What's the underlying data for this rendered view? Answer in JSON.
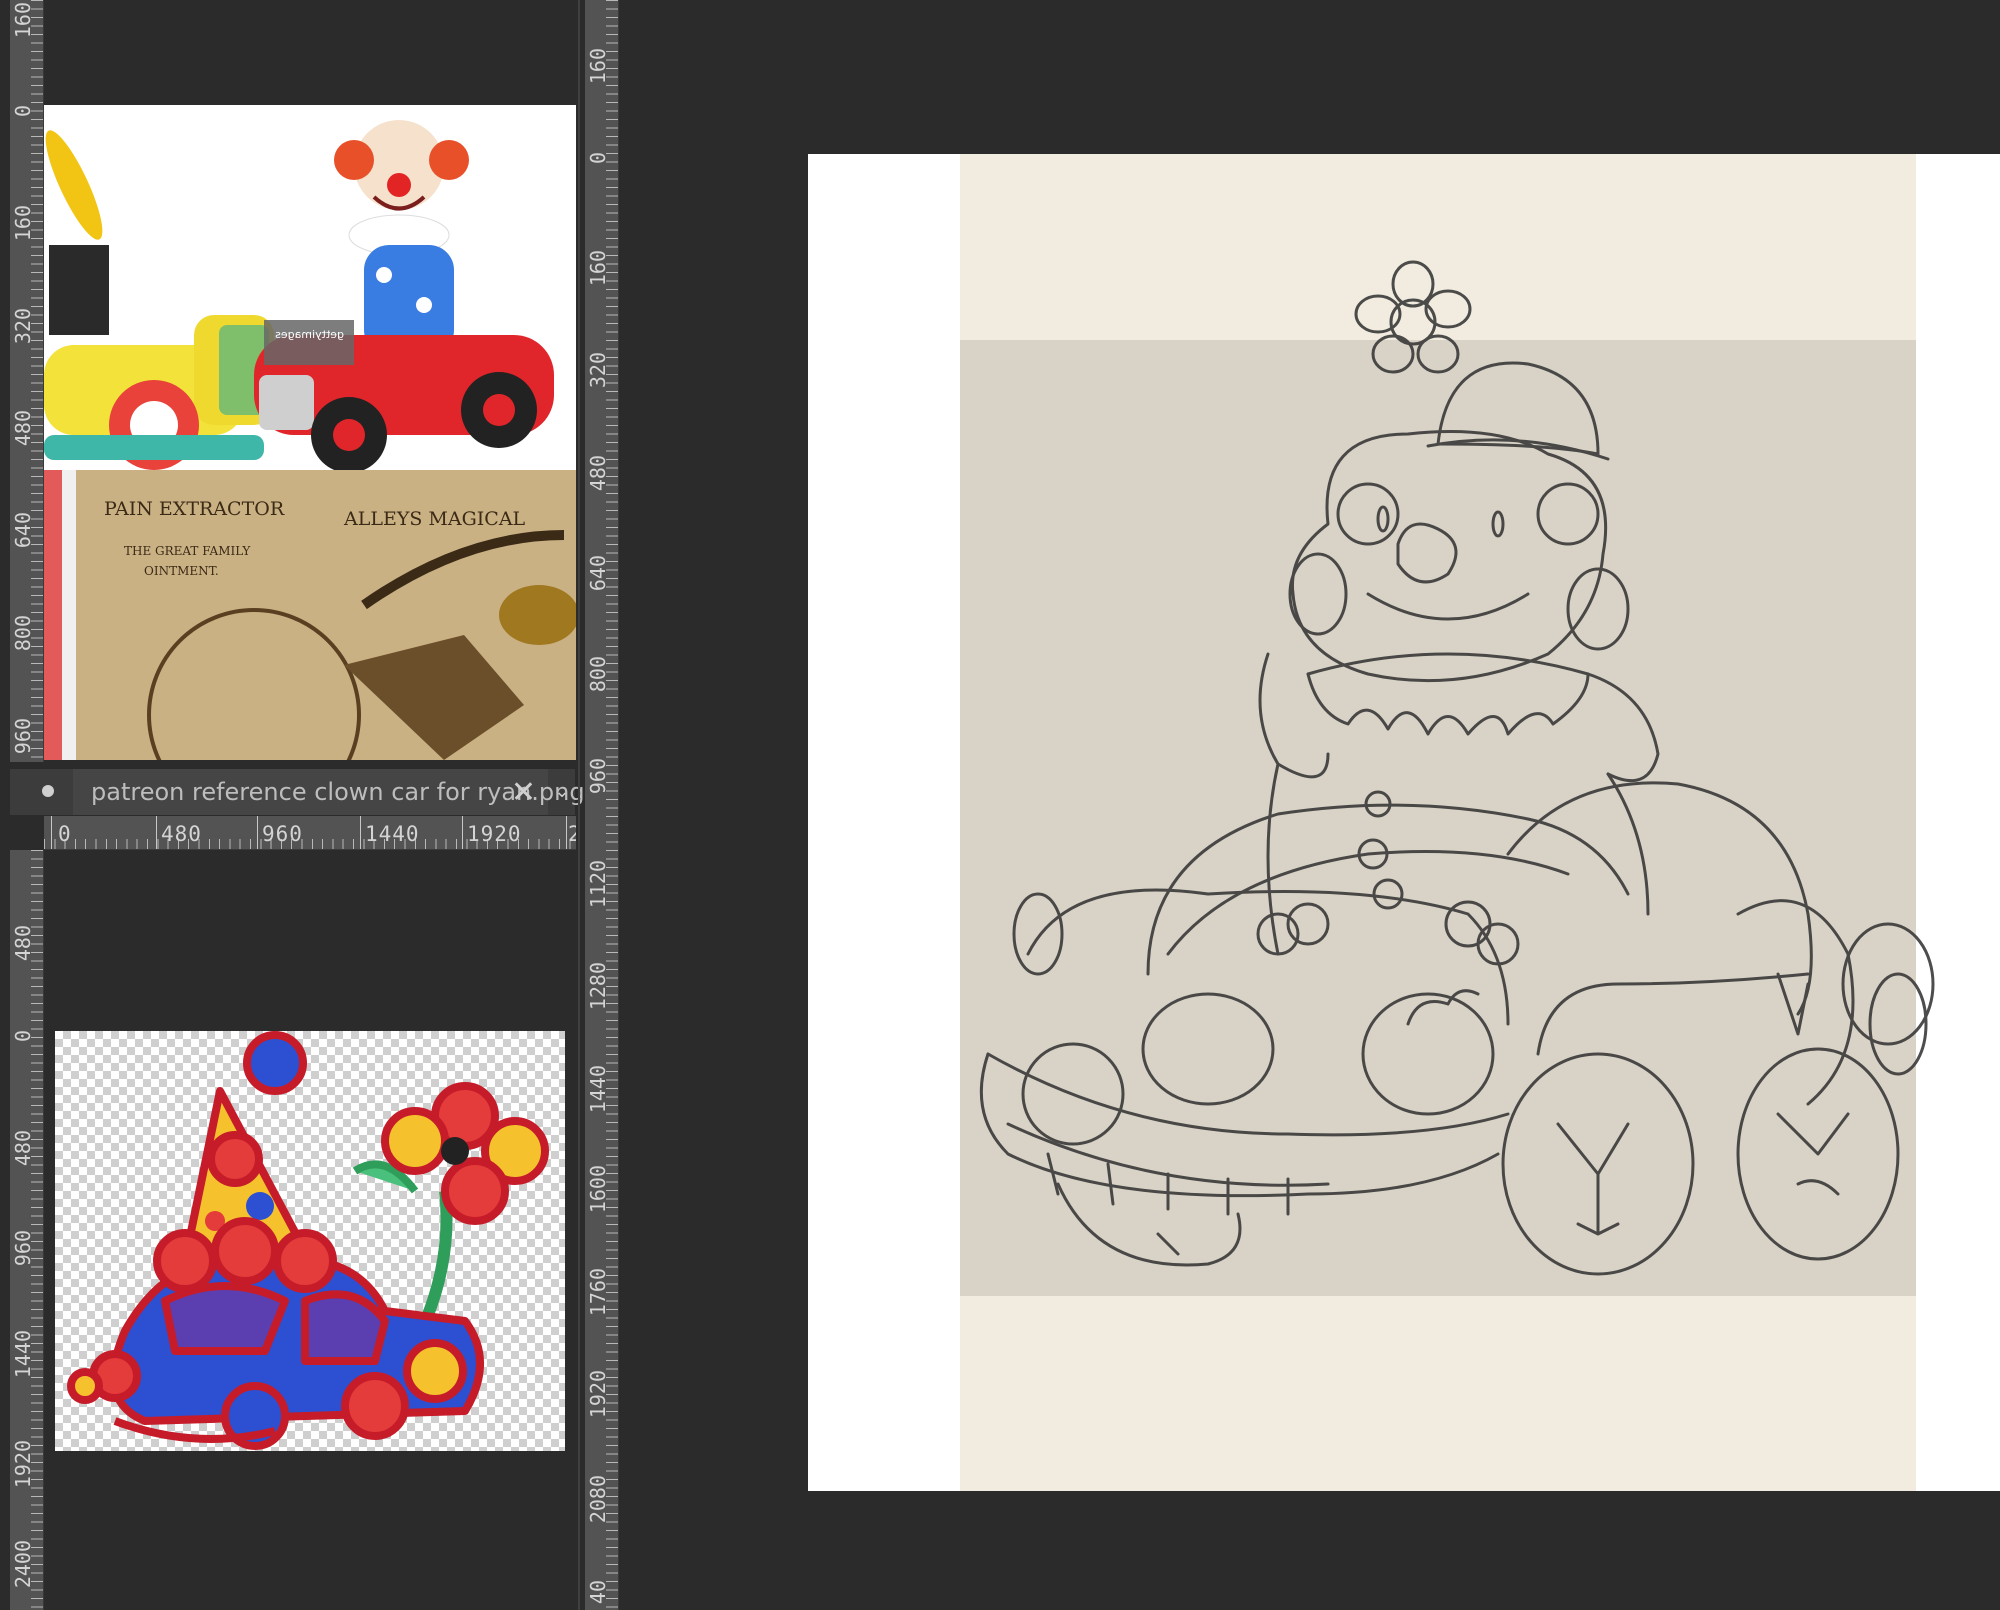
{
  "left_ruler_top": {
    "labels": [
      "160",
      "0",
      "160",
      "320",
      "480",
      "640",
      "800",
      "960"
    ]
  },
  "left_ruler_bottom": {
    "labels": [
      "480",
      "0",
      "480",
      "960",
      "1440",
      "1920",
      "2400"
    ]
  },
  "right_ruler": {
    "labels": [
      "160",
      "0",
      "160",
      "320",
      "480",
      "640",
      "800",
      "960",
      "1120",
      "1280",
      "1440",
      "1600",
      "1760",
      "1920",
      "2080",
      "40"
    ]
  },
  "reference_tab": {
    "label": "patreon reference clown car for ryan.png",
    "close_icon": "close-icon",
    "menu_icon": "chevron-down-icon"
  },
  "h_ruler": {
    "labels": [
      "0",
      "480",
      "960",
      "1440",
      "1920",
      "2"
    ]
  },
  "reference_images": {
    "watermark": "gettyimages",
    "watermark_sub": "Credit: kibels",
    "poster_line1": "ALLEYS MAGICAL",
    "poster_line2": "PAIN EXTRACTOR",
    "poster_line3": "THE GREAT FAMILY",
    "poster_line4": "OINTMENT."
  },
  "colors": {
    "workspace": "#2b2b2b",
    "ruler": "#535353",
    "canvas_paper": "#ffffff",
    "canvas_beige": "#f2ece0",
    "canvas_gray": "#d8d3c6",
    "sketch": "#3a3a3a"
  }
}
